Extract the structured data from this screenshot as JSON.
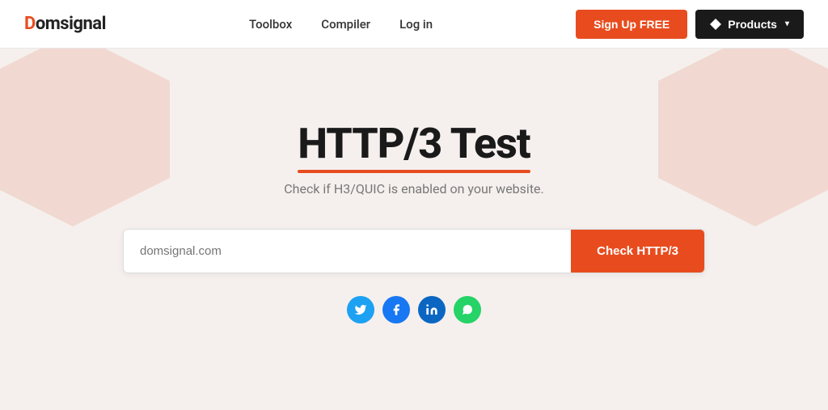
{
  "brand": {
    "logo_d": "D",
    "logo_rest": "omsignal"
  },
  "navbar": {
    "links": [
      {
        "id": "toolbox",
        "label": "Toolbox"
      },
      {
        "id": "compiler",
        "label": "Compiler"
      },
      {
        "id": "login",
        "label": "Log in"
      }
    ],
    "signup_label": "Sign Up FREE",
    "products_label": "Products"
  },
  "hero": {
    "title_part1": "HTTP/3",
    "title_part2": "Test",
    "subtitle": "Check if H3/QUIC is enabled on your website.",
    "input_placeholder": "domsignal.com",
    "check_button_label": "Check HTTP/3"
  },
  "social": [
    {
      "id": "twitter",
      "label": "T",
      "aria": "Twitter"
    },
    {
      "id": "facebook",
      "label": "f",
      "aria": "Facebook"
    },
    {
      "id": "linkedin",
      "label": "in",
      "aria": "LinkedIn"
    },
    {
      "id": "whatsapp",
      "label": "W",
      "aria": "WhatsApp"
    }
  ]
}
